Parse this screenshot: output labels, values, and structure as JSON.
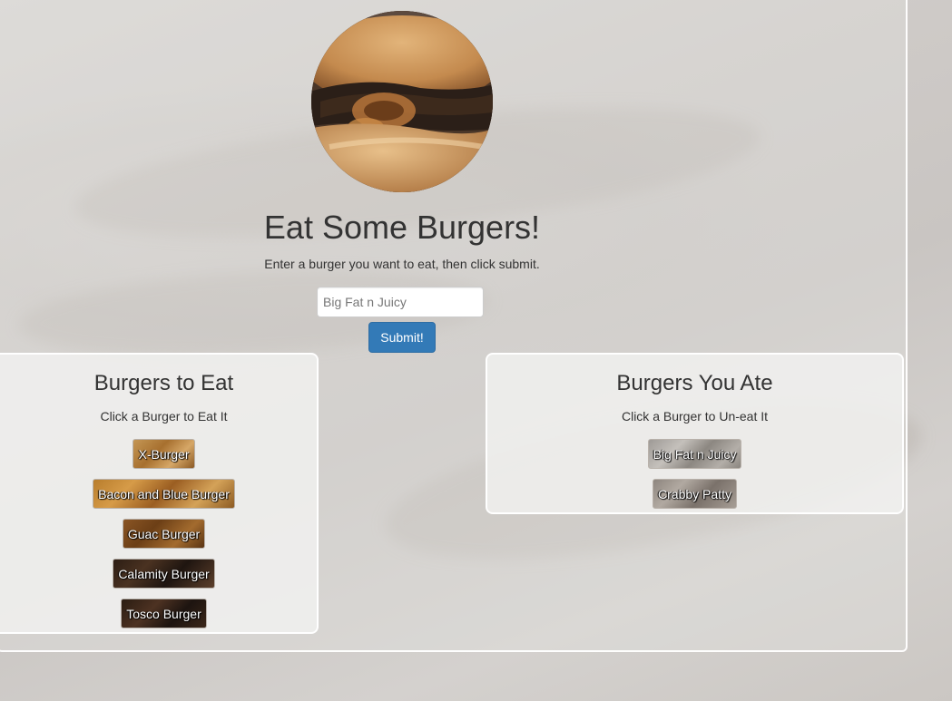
{
  "header": {
    "title": "Eat Some Burgers!",
    "subtitle": "Enter a burger you want to eat, then click submit."
  },
  "form": {
    "input_value": "",
    "input_placeholder": "Big Fat n Juicy",
    "submit_label": "Submit!"
  },
  "to_eat": {
    "heading": "Burgers to Eat",
    "hint": "Click a Burger to Eat It",
    "burgers": [
      "X-Burger",
      "Bacon and Blue Burger",
      "Guac Burger",
      "Calamity Burger",
      "Tosco Burger"
    ]
  },
  "eaten": {
    "heading": "Burgers You Ate",
    "hint": "Click a Burger to Un-eat It",
    "burgers": [
      "Big Fat n Juicy",
      "Crabby Patty"
    ]
  },
  "colors": {
    "submit_bg": "#337ab7",
    "text": "#333333"
  },
  "icons": {
    "avatar": "burger-photo"
  }
}
